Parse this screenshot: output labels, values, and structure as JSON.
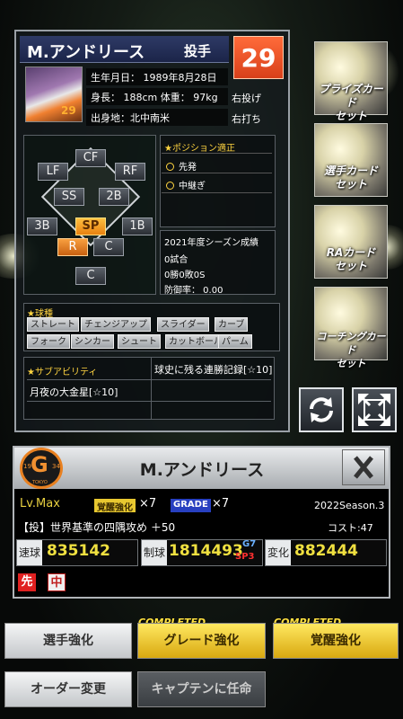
{
  "player": {
    "name": "M.アンドリース",
    "position": "投手",
    "number": "29",
    "portrait_number": "29",
    "birthday": "生年月日： 1989年8月28日",
    "body": "身長： 188cm 体重： 97kg",
    "birthplace": "出身地：北中南米",
    "throws": "右投げ",
    "bats": "右打ち"
  },
  "field": {
    "positions": [
      "CF",
      "LF",
      "RF",
      "SS",
      "2B",
      "3B",
      "SP",
      "1B",
      "R",
      "C",
      "C"
    ]
  },
  "aptitude": {
    "title": "★ポジション適正",
    "items": [
      "先発",
      "中継ぎ"
    ]
  },
  "season_record": {
    "title": "2021年度シーズン成績",
    "games": "0試合",
    "wins": "0勝0敗0S",
    "era": "防御率： 0.00"
  },
  "pitches": {
    "title": "★球種",
    "items": [
      "ストレート",
      "チェンジアップ",
      "スライダー",
      "カーブ",
      "フォーク",
      "シンカー",
      "シュート",
      "カットボール",
      "パーム"
    ]
  },
  "sub_ability": {
    "title": "★サブアビリティ",
    "items": [
      "球史に残る連勝記録[☆10]",
      "月夜の大金星[☆10]"
    ]
  },
  "side_buttons": [
    "プライズカード\nセット",
    "選手カード\nセット",
    "RAカード\nセット",
    "コーチングカード\nセット"
  ],
  "info": {
    "logo_letter": "G",
    "logo_left": "19",
    "logo_right": "34",
    "logo_bottom": "TOKYO",
    "name": "M.アンドリース",
    "level": "Lv.Max",
    "awakening_badge": "覚醒強化",
    "awakening_count": "×7",
    "grade_badge": "GRADE",
    "grade_count": "×7",
    "season": "2022Season.3",
    "skill": "【投】世界基準の四隅攻め ＋50",
    "cost": "コスト:47",
    "stats": [
      {
        "label": "速球",
        "value": "835142"
      },
      {
        "label": "制球",
        "value": "1814493",
        "extra_top": "G7",
        "extra_bottom": "SP3"
      },
      {
        "label": "変化",
        "value": "882444"
      }
    ],
    "tags": [
      "先",
      "中"
    ]
  },
  "buttons": {
    "enhance": "選手強化",
    "grade": "グレード強化",
    "awaken": "覚醒強化",
    "completed": "COMPLETED",
    "order": "オーダー変更",
    "captain": "キャプテンに任命"
  },
  "colors": {
    "number_bg": "#e8502a",
    "stat_value": "#f0e040",
    "logo_orange": "#e88020"
  }
}
